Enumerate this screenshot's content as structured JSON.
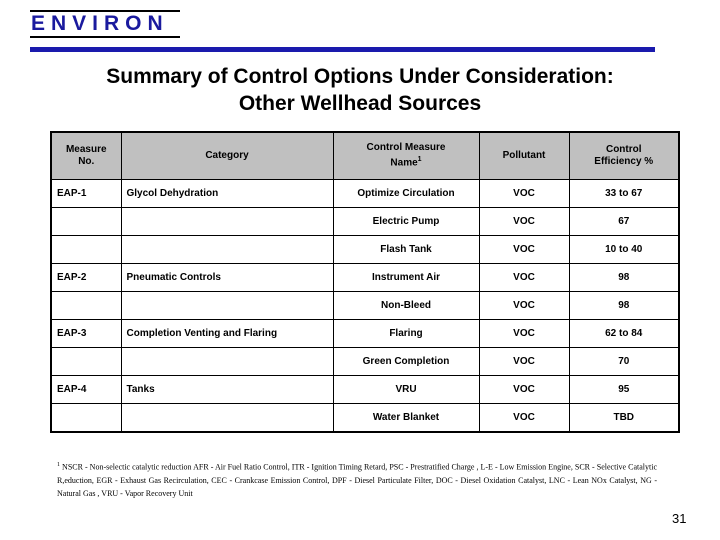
{
  "logo": {
    "wordmark": "ENVIRON",
    "bar_color": "#1a1aad",
    "text_color": "#1a1a9e"
  },
  "title": {
    "line1": "Summary of Control Options Under Consideration:",
    "line2": "Other Wellhead Sources"
  },
  "table": {
    "header_bg": "#c0c0c0",
    "columns": [
      {
        "label_line1": "Measure",
        "label_line2": "No."
      },
      {
        "label_line1": "Category",
        "label_line2": ""
      },
      {
        "label_line1": "Control Measure",
        "label_line2": "Name",
        "superscript": "1"
      },
      {
        "label_line1": "Pollutant",
        "label_line2": ""
      },
      {
        "label_line1": "Control",
        "label_line2": "Efficiency %"
      }
    ],
    "rows": [
      {
        "measure_no": "EAP-1",
        "category": "Glycol Dehydration",
        "control_measure_name": "Optimize Circulation",
        "pollutant": "VOC",
        "control_efficiency": "33 to 67"
      },
      {
        "measure_no": "",
        "category": "",
        "control_measure_name": "Electric Pump",
        "pollutant": "VOC",
        "control_efficiency": "67"
      },
      {
        "measure_no": "",
        "category": "",
        "control_measure_name": "Flash Tank",
        "pollutant": "VOC",
        "control_efficiency": "10 to 40"
      },
      {
        "measure_no": "EAP-2",
        "category": "Pneumatic Controls",
        "control_measure_name": "Instrument Air",
        "pollutant": "VOC",
        "control_efficiency": "98"
      },
      {
        "measure_no": "",
        "category": "",
        "control_measure_name": "Non-Bleed",
        "pollutant": "VOC",
        "control_efficiency": "98"
      },
      {
        "measure_no": "EAP-3",
        "category": "Completion Venting and Flaring",
        "control_measure_name": "Flaring",
        "pollutant": "VOC",
        "control_efficiency": "62 to 84"
      },
      {
        "measure_no": "",
        "category": "",
        "control_measure_name": "Green Completion",
        "pollutant": "VOC",
        "control_efficiency": "70"
      },
      {
        "measure_no": "EAP-4",
        "category": "Tanks",
        "control_measure_name": "VRU",
        "pollutant": "VOC",
        "control_efficiency": "95"
      },
      {
        "measure_no": "",
        "category": "",
        "control_measure_name": "Water Blanket",
        "pollutant": "VOC",
        "control_efficiency": "TBD"
      }
    ]
  },
  "footnote": {
    "marker": "1",
    "text": " NSCR - Non-selectic catalytic reduction  AFR - Air Fuel Ratio Control, ITR - Ignition Timing Retard, PSC - Prestratified Charge , L-E - Low Emission Engine, SCR - Selective Catalytic R,eduction, EGR - Exhaust Gas Recirculation, CEC - Crankcase Emission Control, DPF - Diesel Particulate Filter, DOC - Diesel Oxidation Catalyst, LNC - Lean NOx Catalyst, NG - Natural Gas , VRU - Vapor Recovery Unit"
  },
  "page_number": "31"
}
